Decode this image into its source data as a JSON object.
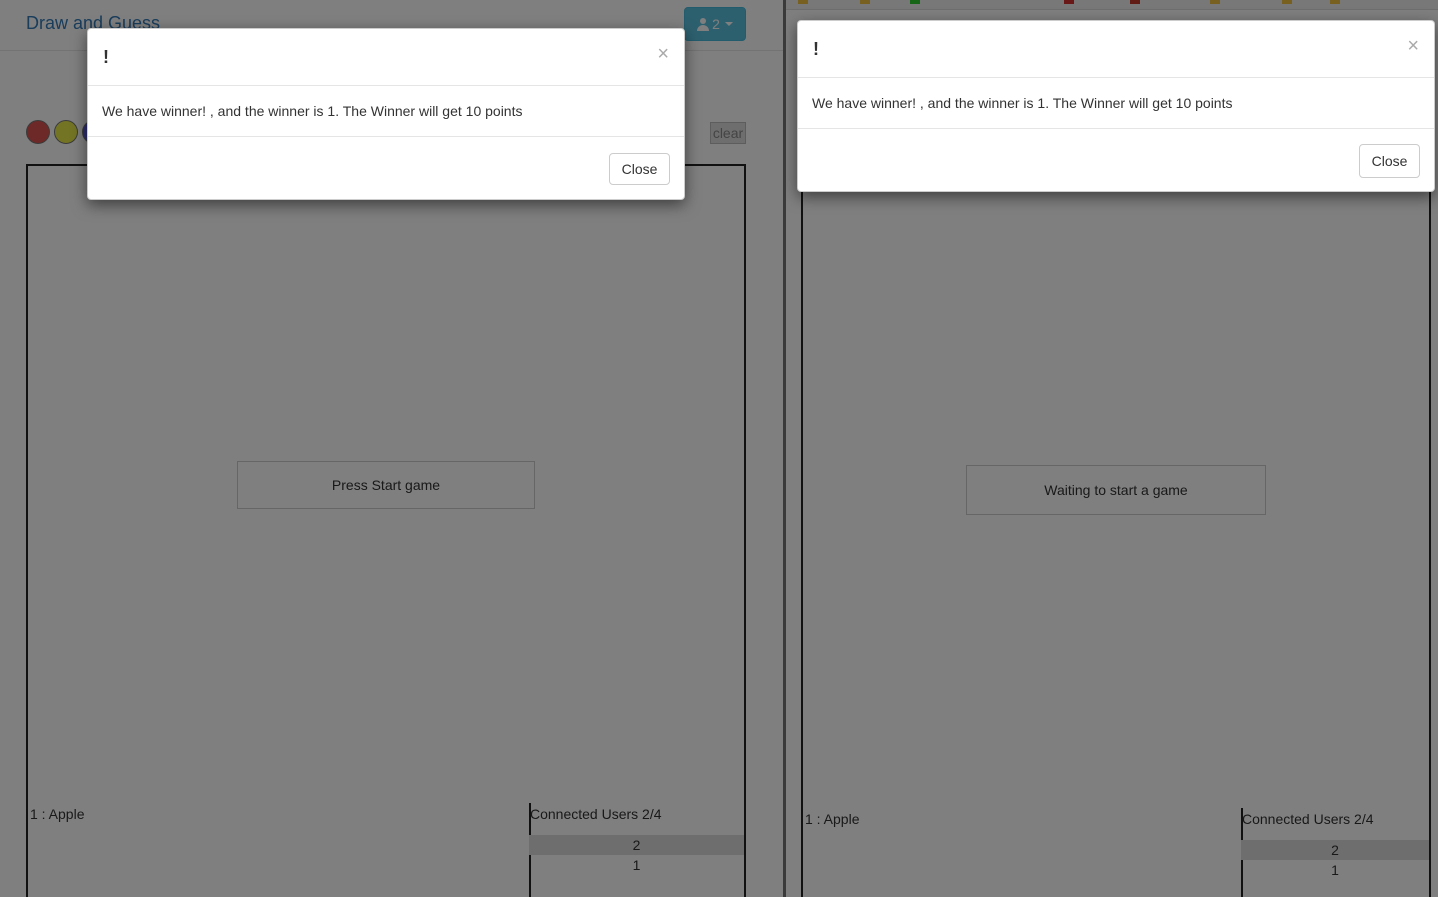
{
  "left": {
    "brand": "Draw and Guess",
    "user_count": "2",
    "colors": [
      "#d9534f",
      "#e8e84a",
      "#5a5ae0"
    ],
    "clear_label": "clear",
    "canvas_message": "Press Start game",
    "word": "1 : Apple",
    "users_title": "Connected Users 2/4",
    "users": [
      "2",
      "1"
    ],
    "modal": {
      "title": "!",
      "close_x": "×",
      "body": "We have winner! , and the winner is 1. The Winner will get 10 points",
      "close_label": "Close"
    }
  },
  "right": {
    "canvas_message": "Waiting to start a game",
    "word": "1 : Apple",
    "users_title": "Connected Users 2/4",
    "users": [
      "2",
      "1"
    ],
    "modal": {
      "title": "!",
      "close_x": "×",
      "body": "We have winner! , and the winner is 1. The Winner will get 10 points",
      "close_label": "Close"
    }
  }
}
